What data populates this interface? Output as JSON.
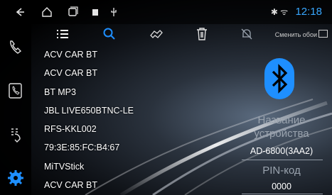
{
  "status": {
    "time": "12:18"
  },
  "devices": [
    "ACV CAR BT",
    "ACV CAR BT",
    "BT MP3",
    "JBL LIVE650BTNC-LE",
    "RFS-KKL002",
    "79:3E:85:FC:B4:67",
    "MiTVStick",
    "ACV CAR BT"
  ],
  "toolbar": {
    "wallpaper_label": "Сменить обои"
  },
  "panel": {
    "name_label_line1": "Название",
    "name_label_line2": "устройства",
    "device_name": "AD-6800(3AA2)",
    "pin_label": "PIN-код",
    "pin_value": "0000"
  },
  "colors": {
    "accent": "#1e8fff",
    "status_blue": "#38a7ff"
  }
}
